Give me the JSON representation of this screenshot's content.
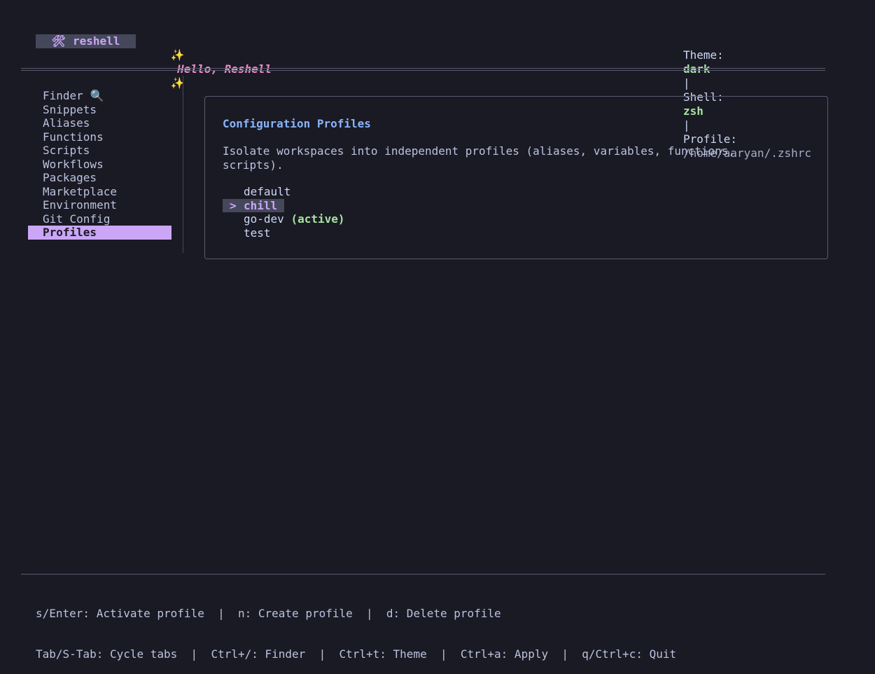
{
  "header": {
    "app_icon": "hammer-wrench-icon",
    "app_icon_glyph": "🛠",
    "app_name": "reshell",
    "sparkle_glyph": "✨",
    "greeting": "Hello, Reshell",
    "theme_label": "Theme:",
    "theme_value": "dark",
    "separator": "|",
    "shell_label": "Shell:",
    "shell_value": "zsh",
    "profile_label": "Profile:",
    "profile_value": "/home/aaryan/.zshrc"
  },
  "sidebar": {
    "items": [
      {
        "label": "Finder",
        "icon_glyph": "🔍",
        "icon": "magnifier-icon"
      },
      {
        "label": "Snippets"
      },
      {
        "label": "Aliases"
      },
      {
        "label": "Functions"
      },
      {
        "label": "Scripts"
      },
      {
        "label": "Workflows"
      },
      {
        "label": "Packages"
      },
      {
        "label": "Marketplace"
      },
      {
        "label": "Environment"
      },
      {
        "label": "Git Config"
      },
      {
        "label": "Profiles",
        "active": true
      }
    ]
  },
  "main": {
    "title": "Configuration Profiles",
    "description": "Isolate workspaces into independent profiles (aliases, variables, functions, scripts).",
    "cursor_glyph": ">",
    "profiles": [
      {
        "name": "default"
      },
      {
        "name": "chill",
        "selected": true
      },
      {
        "name": "go-dev",
        "tag": "(active)"
      },
      {
        "name": "test"
      }
    ]
  },
  "footer": {
    "line1": "s/Enter: Activate profile  |  n: Create profile  |  d: Delete profile",
    "line2": "Tab/S-Tab: Cycle tabs  |  Ctrl+/: Finder  |  Ctrl+t: Theme  |  Ctrl+a: Apply  |  q/Ctrl+c: Quit"
  },
  "colors": {
    "background": "#1a1a24",
    "accent_purple": "#cba6f7",
    "accent_pink": "#f58ac6",
    "accent_green": "#a6e3a1",
    "accent_blue": "#89b4fa",
    "highlight_bg": "#45475a"
  }
}
